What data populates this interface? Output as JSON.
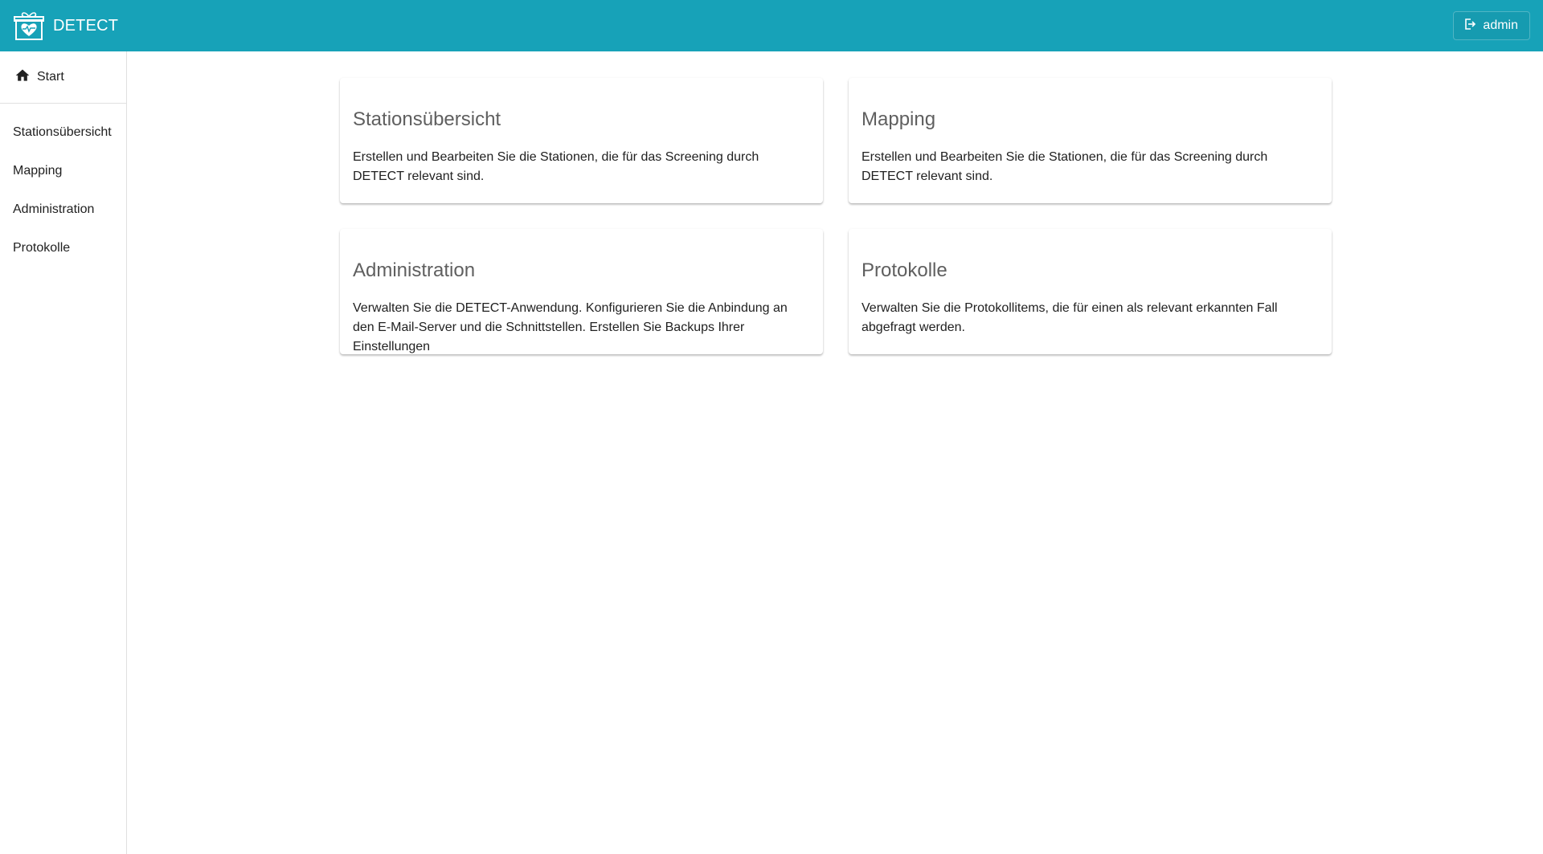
{
  "header": {
    "app_title": "DETECT",
    "logo_icon": "gift-heart-logo-icon",
    "user_label": "admin",
    "user_icon": "logout-icon",
    "bar_color": "#17a2b8"
  },
  "sidebar": {
    "start_label": "Start",
    "start_icon": "home-icon",
    "items": [
      {
        "label": "Stationsübersicht"
      },
      {
        "label": "Mapping"
      },
      {
        "label": "Administration"
      },
      {
        "label": "Protokolle"
      }
    ]
  },
  "cards": [
    {
      "title": "Stationsübersicht",
      "text": "Erstellen und Bearbeiten Sie die Stationen, die für das Screening durch DETECT relevant sind."
    },
    {
      "title": "Mapping",
      "text": "Erstellen und Bearbeiten Sie die Stationen, die für das Screening durch DETECT relevant sind."
    },
    {
      "title": "Administration",
      "text": "Verwalten Sie die DETECT-Anwendung. Konfigurieren Sie die Anbindung an den E-Mail-Server und die Schnittstellen. Erstellen Sie Backups Ihrer Einstellungen"
    },
    {
      "title": "Protokolle",
      "text": "Verwalten Sie die Protokollitems, die für einen als relevant erkannten Fall abgefragt werden."
    }
  ]
}
